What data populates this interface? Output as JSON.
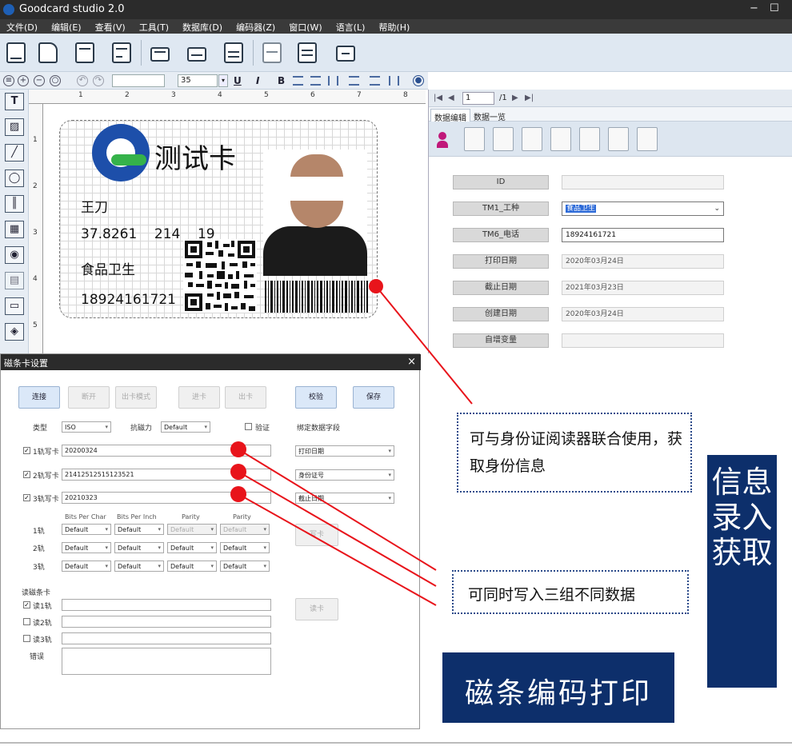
{
  "app": {
    "title": "Goodcard studio 2.0",
    "minimize": "−",
    "maximize": "☐"
  },
  "menu": [
    "文件(D)",
    "编辑(E)",
    "查看(V)",
    "工具(T)",
    "数据库(D)",
    "编码器(Z)",
    "窗口(W)",
    "语言(L)",
    "帮助(H)"
  ],
  "format_bar": {
    "font_name": "",
    "font_size": "35",
    "underline": "U",
    "italic": "I",
    "bold": "B"
  },
  "left_tools": {
    "text_tool": "T"
  },
  "ruler": {
    "h": [
      "1",
      "2",
      "3",
      "4",
      "5",
      "6",
      "7",
      "8"
    ],
    "v": [
      "1",
      "2",
      "3",
      "4",
      "5"
    ]
  },
  "card": {
    "title": "测试卡",
    "name": "王刀",
    "id_number": "37.8261    214    19",
    "job": "食品卫生",
    "phone": "18924161721"
  },
  "right_panel": {
    "page_current": "1",
    "page_total": "/1",
    "tabs": [
      "数据编辑",
      "数据一览"
    ],
    "fields": [
      {
        "label": "ID",
        "value": ""
      },
      {
        "label": "TM1_工种",
        "value": "食品卫生"
      },
      {
        "label": "TM6_电话",
        "value": "18924161721"
      },
      {
        "label": "打印日期",
        "value": "2020年03月24日"
      },
      {
        "label": "截止日期",
        "value": "2021年03月23日"
      },
      {
        "label": "创建日期",
        "value": "2020年03月24日"
      },
      {
        "label": "自增变量",
        "value": ""
      }
    ]
  },
  "dialog": {
    "title": "磁条卡设置",
    "close": "×",
    "buttons": {
      "connect": "连接",
      "disconnect": "断开",
      "eject_mode": "出卡模式",
      "feed": "进卡",
      "eject": "出卡",
      "verify": "校验",
      "save": "保存",
      "write": "写卡",
      "read": "读卡"
    },
    "type_label": "类型",
    "type_value": "ISO",
    "coercivity_label": "抗磁力",
    "coercivity_value": "Default",
    "verify_label": "验证",
    "bind_label": "绑定数据字段",
    "tracks": [
      {
        "label": "1轨写卡",
        "value": "20200324",
        "bind": "打印日期"
      },
      {
        "label": "2轨写卡",
        "value": "21412512515123521",
        "bind": "身份证号"
      },
      {
        "label": "3轨写卡",
        "value": "20210323",
        "bind": "截止日期"
      }
    ],
    "col_headers": [
      "Bits Per Char",
      "Bits Per Inch",
      "Parity",
      "Parity"
    ],
    "track_rows": [
      "1轨",
      "2轨",
      "3轨"
    ],
    "default": "Default",
    "read_section": "读磁条卡",
    "read_rows": [
      "读1轨",
      "读2轨",
      "读3轨"
    ],
    "error_label": "错误"
  },
  "annotations": {
    "callout1": "可与身份证阅读器联合使用，获取身份信息",
    "callout2": "可同时写入三组不同数据",
    "banner_vertical": "信息录入获取",
    "banner_horizontal": "磁条编码打印"
  },
  "colors": {
    "navy": "#0d2f6b",
    "red": "#e8141b",
    "logo_blue": "#1d4faa",
    "logo_green": "#35b24a"
  }
}
